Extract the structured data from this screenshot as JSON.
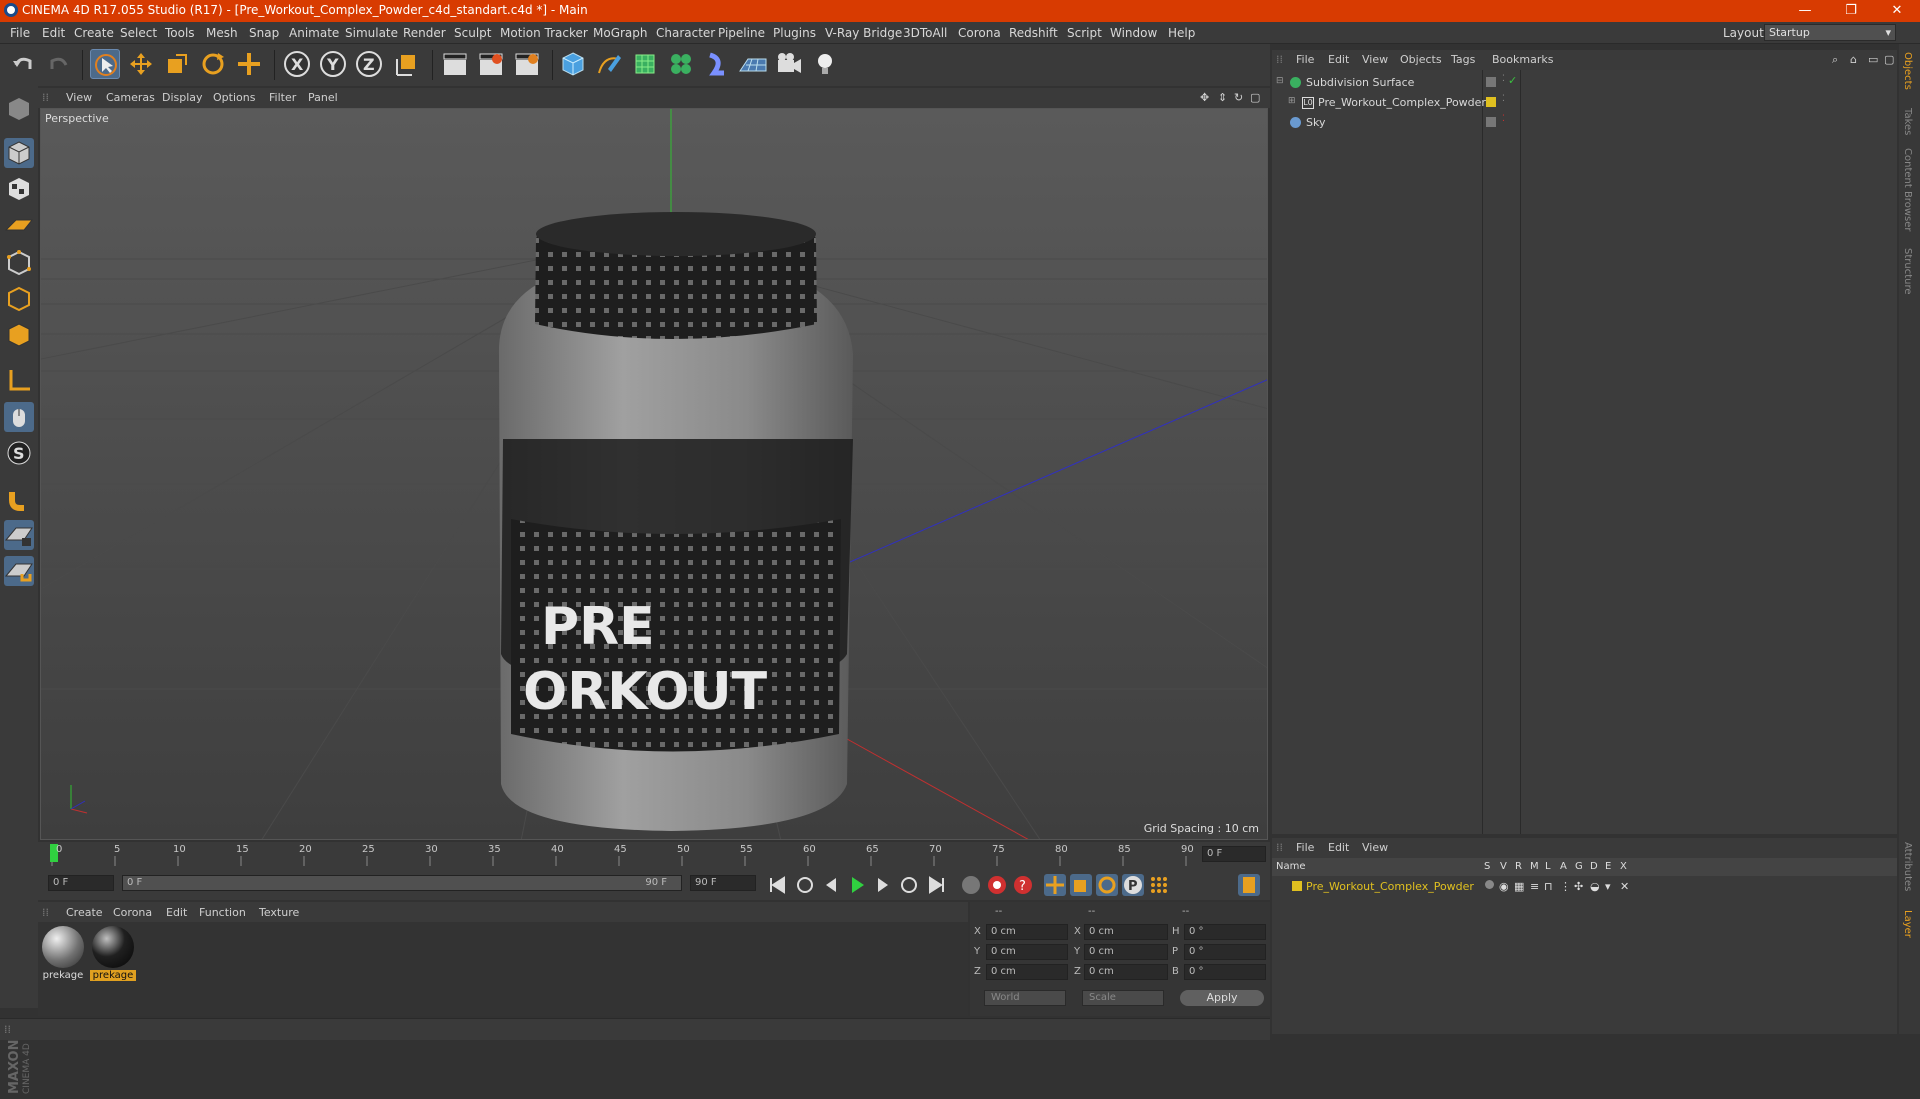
{
  "window": {
    "title": "CINEMA 4D R17.055 Studio (R17) - [Pre_Workout_Complex_Powder_c4d_standart.c4d *] - Main",
    "minimize": "—",
    "restore": "❐",
    "close": "✕"
  },
  "menubar": {
    "items": [
      "File",
      "Edit",
      "Create",
      "Select",
      "Tools",
      "Mesh",
      "Snap",
      "Animate",
      "Simulate",
      "Render",
      "Sculpt",
      "Motion Tracker",
      "MoGraph",
      "Character",
      "Pipeline",
      "Plugins",
      "V-Ray Bridge",
      "3DToAll",
      "Corona",
      "Redshift",
      "Script",
      "Window",
      "Help"
    ],
    "layout_label": "Layout:",
    "layout_value": "Startup"
  },
  "viewport": {
    "menu": [
      "View",
      "Cameras",
      "Display",
      "Options",
      "Filter",
      "Panel"
    ],
    "label": "Perspective",
    "grid_spacing": "Grid Spacing : 10 cm",
    "object_text_line1": "PRE",
    "object_text_line2": "ORKOUT"
  },
  "timeline": {
    "ticks": [
      "0",
      "5",
      "10",
      "15",
      "20",
      "25",
      "30",
      "35",
      "40",
      "45",
      "50",
      "55",
      "60",
      "65",
      "70",
      "75",
      "80",
      "85",
      "90"
    ],
    "end_field": "0 F",
    "current_frame": "0 F",
    "range_start": "0 F",
    "range_end": "90 F",
    "max_frame": "90 F"
  },
  "material_manager": {
    "menu": [
      "Create",
      "Corona",
      "Edit",
      "Function",
      "Texture"
    ],
    "materials": [
      {
        "name": "prekage",
        "selected": false
      },
      {
        "name": "prekage",
        "selected": true
      }
    ]
  },
  "coordinates": {
    "headers": [
      "--",
      "--",
      "--"
    ],
    "rows": [
      {
        "a": "X",
        "v1": "0 cm",
        "b": "X",
        "v2": "0 cm",
        "c": "H",
        "v3": "0 °"
      },
      {
        "a": "Y",
        "v1": "0 cm",
        "b": "Y",
        "v2": "0 cm",
        "c": "P",
        "v3": "0 °"
      },
      {
        "a": "Z",
        "v1": "0 cm",
        "b": "Z",
        "v2": "0 cm",
        "c": "B",
        "v3": "0 °"
      }
    ],
    "world": "World",
    "scale": "Scale",
    "apply": "Apply"
  },
  "object_manager": {
    "menu": [
      "File",
      "Edit",
      "View",
      "Objects",
      "Tags",
      "Bookmarks"
    ],
    "objects": [
      {
        "name": "Subdivision Surface"
      },
      {
        "name": "Pre_Workout_Complex_Powder"
      },
      {
        "name": "Sky"
      }
    ]
  },
  "layer_manager": {
    "menu": [
      "File",
      "Edit",
      "View"
    ],
    "name_header": "Name",
    "columns": [
      "S",
      "V",
      "R",
      "M",
      "L",
      "A",
      "G",
      "D",
      "E",
      "X"
    ],
    "layers": [
      {
        "name": "Pre_Workout_Complex_Powder"
      }
    ]
  },
  "right_tabs": [
    "Objects",
    "Takes",
    "Content Browser",
    "Structure",
    "Attributes",
    "Layer"
  ],
  "maxon": {
    "line1": "MAXON",
    "line2": "CINEMA 4D"
  },
  "colors": {
    "title_bar": "#d83b01",
    "accent": "#4c6a8a",
    "layer_yellow": "#e0c020",
    "x_axis": "#c03030",
    "y_axis": "#30c030",
    "z_axis": "#3030c0"
  }
}
